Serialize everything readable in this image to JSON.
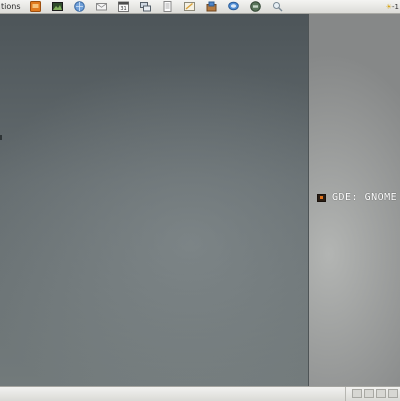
{
  "top_panel": {
    "applications_label": "tions",
    "launchers": [
      {
        "icon": "terminal-icon"
      },
      {
        "icon": "image-viewer-icon"
      },
      {
        "icon": "web-browser-icon"
      },
      {
        "icon": "mail-icon"
      },
      {
        "icon": "calendar-icon"
      },
      {
        "icon": "network-icon"
      },
      {
        "icon": "text-document-icon"
      },
      {
        "icon": "text-editor-icon"
      },
      {
        "icon": "package-manager-icon"
      },
      {
        "icon": "chat-icon"
      },
      {
        "icon": "game-icon"
      },
      {
        "icon": "search-icon"
      }
    ],
    "tray_weather": "-1"
  },
  "desktop": {
    "gde_label": "GDE: GNOME"
  },
  "colors": {
    "panel": "#e8e8e4",
    "desktop": "#5f676b",
    "side_panel": "#a3a5a4"
  }
}
